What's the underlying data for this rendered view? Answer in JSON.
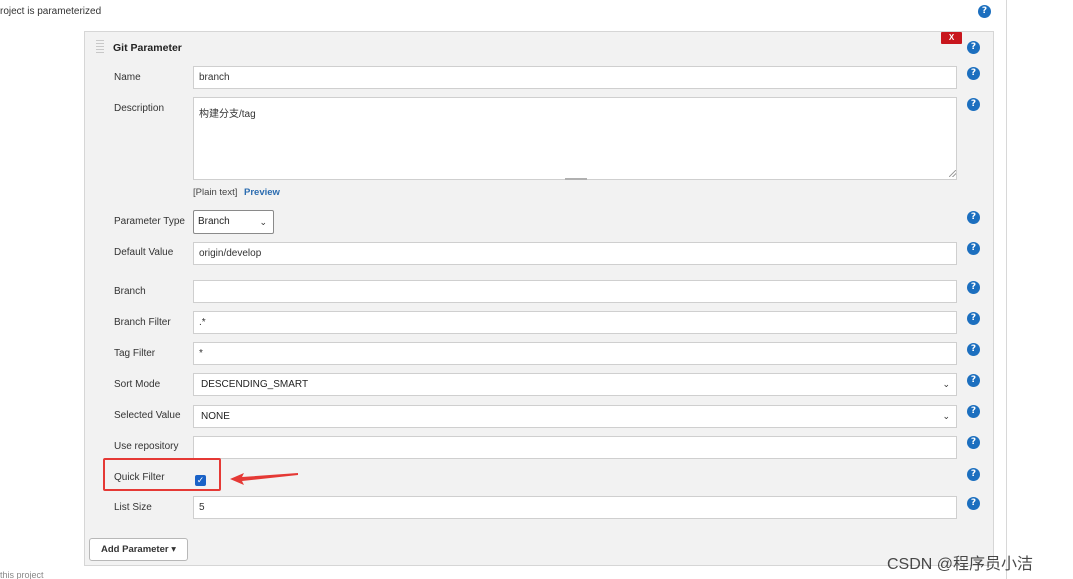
{
  "header": {
    "project_parameterized": "roject is parameterized"
  },
  "panel": {
    "title": "Git Parameter",
    "delete_label": "X"
  },
  "fields": {
    "name": {
      "label": "Name",
      "value": "branch"
    },
    "description": {
      "label": "Description",
      "value": "构建分支/tag"
    },
    "format_plain": "[Plain text]",
    "format_preview": "Preview",
    "parameter_type": {
      "label": "Parameter Type",
      "value": "Branch"
    },
    "default_value": {
      "label": "Default Value",
      "value": "origin/develop"
    },
    "branch": {
      "label": "Branch",
      "value": ""
    },
    "branch_filter": {
      "label": "Branch Filter",
      "value": ".*"
    },
    "tag_filter": {
      "label": "Tag Filter",
      "value": "*"
    },
    "sort_mode": {
      "label": "Sort Mode",
      "value": "DESCENDING_SMART"
    },
    "selected_value": {
      "label": "Selected Value",
      "value": "NONE"
    },
    "use_repository": {
      "label": "Use repository",
      "value": ""
    },
    "quick_filter": {
      "label": "Quick Filter",
      "checked": true
    },
    "list_size": {
      "label": "List Size",
      "value": "5"
    }
  },
  "footer": {
    "add_parameter": "Add Parameter ▾"
  },
  "watermark": "CSDN @程序员小洁",
  "bottom_text": "this project",
  "icons": {
    "help": "?",
    "chevron": "⌄",
    "check": "✓"
  },
  "colors": {
    "help_icon": "#1c6fbf",
    "delete_button": "#c8161d",
    "highlight": "#e53935",
    "preview_link": "#2b6cb0",
    "checkbox": "#1a62c7"
  }
}
